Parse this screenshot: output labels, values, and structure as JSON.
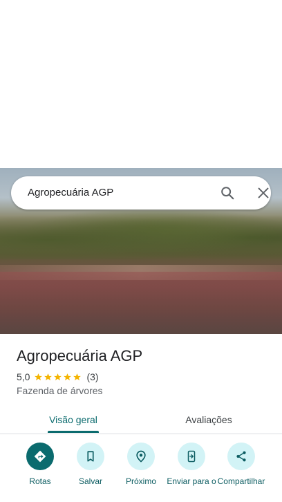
{
  "search": {
    "query": "Agropecuária AGP"
  },
  "place": {
    "name": "Agropecuária AGP",
    "rating": "5,0",
    "stars": 5,
    "review_count": "(3)",
    "category": "Fazenda de árvores"
  },
  "tabs": [
    {
      "label": "Visão geral",
      "selected": true
    },
    {
      "label": "Avaliações",
      "selected": false
    }
  ],
  "actions": [
    {
      "label": "Rotas",
      "icon": "directions-icon"
    },
    {
      "label": "Salvar",
      "icon": "bookmark-icon"
    },
    {
      "label": "Próximo",
      "icon": "nearby-icon"
    },
    {
      "label": "Enviar para o",
      "icon": "send-to-phone-icon"
    },
    {
      "label": "Compartilhar",
      "icon": "share-icon"
    }
  ],
  "colors": {
    "accent": "#0b6b6e",
    "action_bg": "#d2f3f6",
    "star": "#f4b400"
  }
}
